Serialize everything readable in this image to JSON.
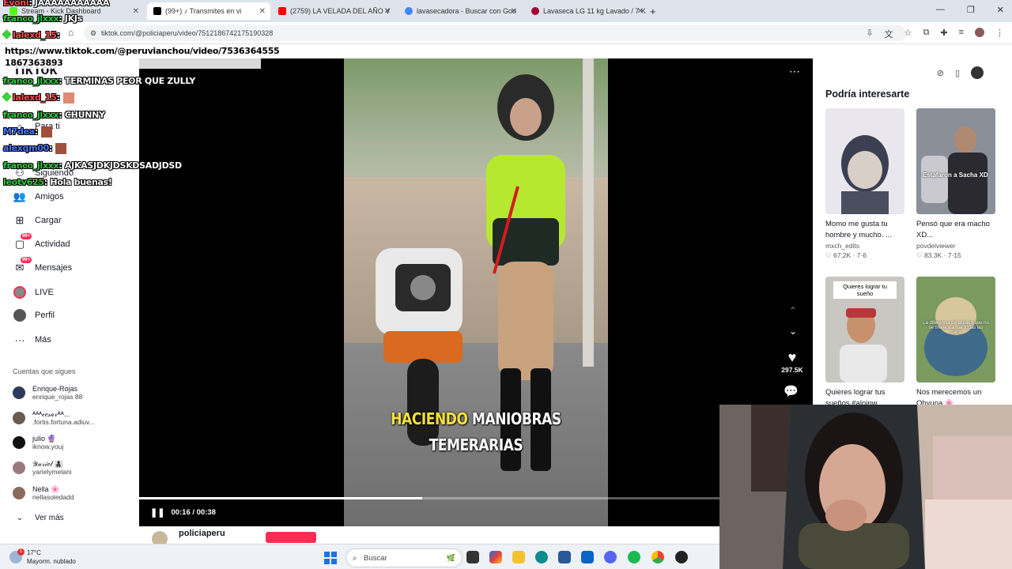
{
  "browser": {
    "tabs": [
      {
        "label": "Stream - Kick Dashboard",
        "color": "#53fc18"
      },
      {
        "label": "(99+) ♪ Transmites en vi",
        "color": "#000000"
      },
      {
        "label": "(2759) LA VELADA DEL AÑO V",
        "color": "#ff0000"
      },
      {
        "label": "lavasecadora - Buscar con Goo",
        "color": "#4285f4"
      },
      {
        "label": "Lavaseca LG 11 kg Lavado / 7 K",
        "color": "#a50034"
      }
    ],
    "new_tab": "+",
    "url": "tiktok.com/@policiaperu/video/7512186742175190328"
  },
  "chat_overlay": {
    "lines": [
      {
        "user": "Evoni",
        "text": ": JAAAAAAAAAAA",
        "user_color": "#ff4d4d"
      },
      {
        "user": "franco_jlxxx",
        "text": ": JKJs",
        "user_color": "#2ecc40"
      },
      {
        "user": "lalexd_15",
        "text": ":",
        "user_color": "#ff4d4d"
      },
      {
        "user": "",
        "text": "https://www.tiktok.com/@peruvianchou/video/7536364555 1867363893",
        "user_color": "#ffffff"
      },
      {
        "user": "franco_jlxxx",
        "text": ": TERMINAS PEOR QUE ZULLY",
        "user_color": "#2ecc40"
      },
      {
        "user": "lalexd_15",
        "text": ":",
        "user_color": "#ff4d4d"
      },
      {
        "user": "franco_jlxxx",
        "text": ": CHUNNY",
        "user_color": "#2ecc40"
      },
      {
        "user": "M7dea",
        "text": ":",
        "user_color": "#4d79ff"
      },
      {
        "user": "alexqm00",
        "text": ":",
        "user_color": "#4d79ff"
      },
      {
        "user": "franco_jlxxx",
        "text": ": AJKASJDKJDSKDSADJDSD",
        "user_color": "#2ecc40"
      },
      {
        "user": "leotv625",
        "text": ": Hola buenas!",
        "user_color": "#2ecc40"
      }
    ]
  },
  "sidebar": {
    "logo": "TikTok",
    "items": [
      {
        "label": "Para ti",
        "icon": "home-icon"
      },
      {
        "label": "Siguiendo",
        "icon": "following-icon"
      },
      {
        "label": "Amigos",
        "icon": "friends-icon"
      },
      {
        "label": "Cargar",
        "icon": "upload-icon"
      },
      {
        "label": "Actividad",
        "icon": "activity-icon",
        "badge": "99+"
      },
      {
        "label": "Mensajes",
        "icon": "messages-icon",
        "badge": "99+"
      },
      {
        "label": "LIVE",
        "icon": "live-icon"
      },
      {
        "label": "Perfil",
        "icon": "profile-icon"
      },
      {
        "label": "Más",
        "icon": "more-icon"
      }
    ],
    "following_header": "Cuentas que sigues",
    "following": [
      {
        "name": "Enrique-Rojas",
        "handle": "enrique_rojas 88",
        "color": "#2d3a5c"
      },
      {
        "name": "ᴬᴬᴬ𝒸𝑒𝓈𝒶𝓇ᴬᴬ...",
        "handle": ".fortis.fortuna.adiuv...",
        "color": "#6b5a50"
      },
      {
        "name": "julio 🔮",
        "handle": "iknow.youj",
        "color": "#111111"
      },
      {
        "name": "𝒴𝒶𝓇𝒾𝑒𝓁 👩‍👧‍👦",
        "handle": "yarielymelani",
        "color": "#9a7a80"
      },
      {
        "name": "Nella 🌸",
        "handle": "nellasoledadd",
        "color": "#8a6a5a"
      }
    ],
    "see_more": "Ver más"
  },
  "player": {
    "caption_highlight": "HACIENDO",
    "caption_rest": " MANIOBRAS",
    "caption_line2": "TEMERARIAS",
    "time": "00:16 / 00:38",
    "progress": 0.42,
    "likes": "297.5K",
    "author": "policiaperu"
  },
  "recommend": {
    "title": "Podría interesarte",
    "cards": [
      {
        "title": "Momo me gusta tu hombre y mucho. ...",
        "author": "mxch_edits",
        "stats": "♡ 67.2K · 7·6",
        "bg": "#e9e6ee",
        "tag": ""
      },
      {
        "title": "Pensó que era macho XD...",
        "author": "povdelviewer",
        "stats": "♡ 83.3K · 7·15",
        "bg": "#6a6f78",
        "tag": "Estafaron a Sacha XD"
      },
      {
        "title": "Quieres lograr tus sueños #aloinw...",
        "author": "",
        "stats": "",
        "bg": "#c9c7c2",
        "tag": "Quieres lograr tu sueño"
      },
      {
        "title": "Nos merecemos un Ohyuna 🌸...",
        "author": "",
        "stats": "",
        "bg": "#7a9a60",
        "tag": "La diferencia de alguien que no se merece amar todas las gana"
      }
    ]
  },
  "taskbar": {
    "weather_temp": "17°C",
    "weather_desc": "Mayorm. nublado",
    "weather_badge": "1",
    "search_label": "Buscar"
  }
}
